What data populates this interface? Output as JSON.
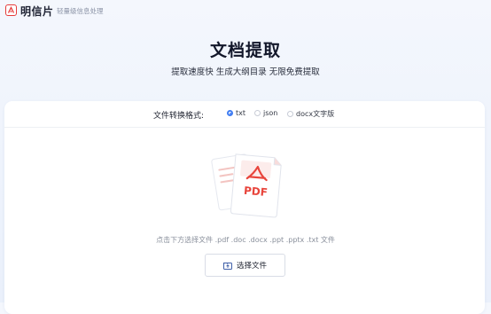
{
  "header": {
    "brand": "明信片",
    "tagline": "轻量级信息处理"
  },
  "hero": {
    "title": "文档提取",
    "subtitle": "提取速度快 生成大纲目录 无限免费提取"
  },
  "format": {
    "label": "文件转换格式:",
    "options": [
      {
        "label": "txt",
        "selected": true
      },
      {
        "label": "json",
        "selected": false
      },
      {
        "label": "docx文字版",
        "selected": false
      }
    ]
  },
  "upload": {
    "illustration_text": "PDF",
    "hint": "点击下方选择文件  .pdf .doc .docx .ppt .pptx .txt 文件",
    "button_label": "选择文件"
  },
  "colors": {
    "accent": "#3f7cf2",
    "pdf_red": "#e8453c",
    "logo_red": "#e63b3b"
  },
  "icons": {
    "logo": "brand-logo-icon",
    "upload_button": "folder-upload-icon",
    "illustration": "pdf-file-icon"
  }
}
